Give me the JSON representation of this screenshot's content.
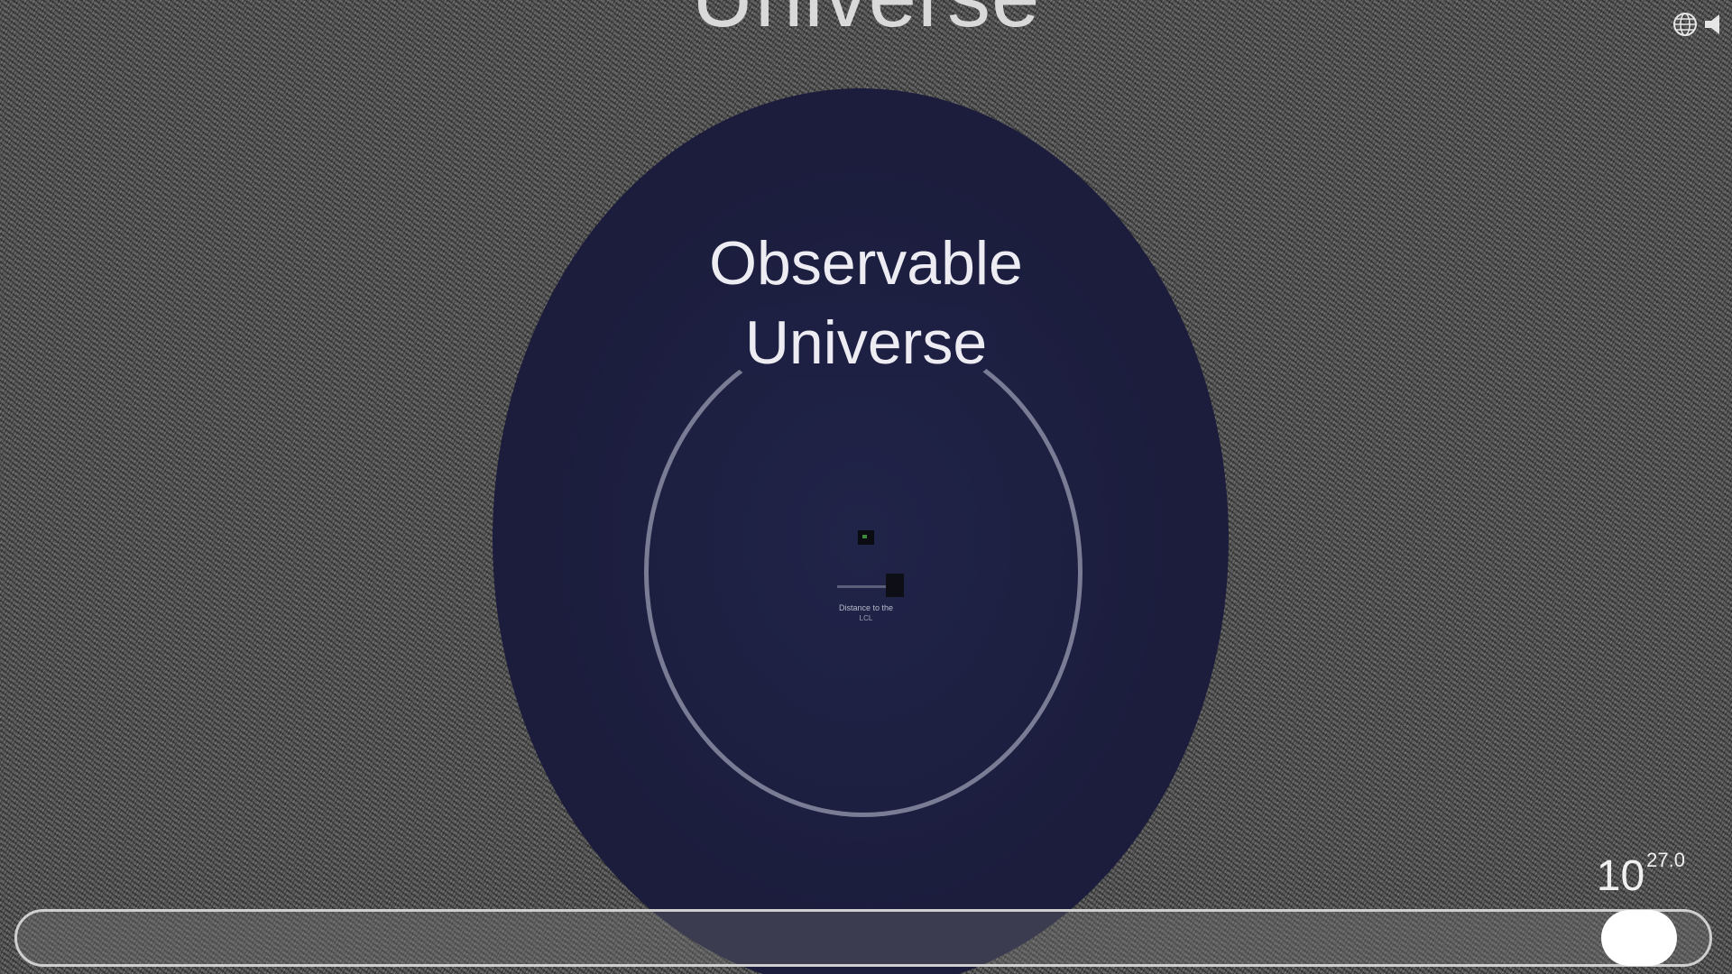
{
  "header": {
    "outer_title": "Universe"
  },
  "canvas": {
    "region_title": "Observable Universe",
    "region_title_line1": "Observable",
    "region_title_line2": "Universe",
    "small_label_1": "",
    "small_label_2": "Distance to the",
    "small_label_3": "LCL"
  },
  "toolbar": {
    "language_icon": "globe-icon",
    "sound_icon": "speaker-icon"
  },
  "scale": {
    "base": "10",
    "exponent": "27.0"
  },
  "zoom_slider": {
    "value_fraction": 0.98
  },
  "colors": {
    "background_noise": "#5b5b5b",
    "universe_disc": "#1c1d3d",
    "ring": "#7a7c95",
    "text": "#ececf2",
    "slider_thumb": "#ffffff"
  }
}
